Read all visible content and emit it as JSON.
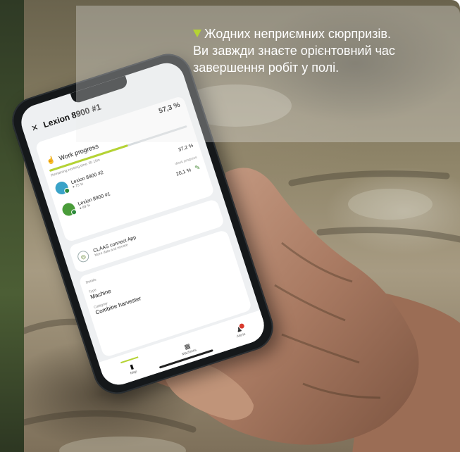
{
  "caption": {
    "lines": [
      "Жодних неприємних сюрпризів.",
      "Ви завжди знаєте орієнтовний час",
      "завершення робіт у полі."
    ],
    "accent_color": "#b5d334"
  },
  "phone_app": {
    "close_icon": "close-icon",
    "title": "Lexion 8900 #1",
    "progress_card": {
      "total_percent": "57,3 %",
      "progress_fraction": 0.573,
      "label": "Work progress",
      "remaining": "Remaining working time: 3h 15m",
      "machines": [
        {
          "name": "Lexion 8900 #2",
          "sub": "● 75 %",
          "percent": "37,2 %",
          "color": "#3aa3c8"
        },
        {
          "name": "Lexion 8900 #1",
          "sub": "● 89 %",
          "percent": "20,1 %",
          "color": "#4a9c3a"
        }
      ],
      "link": "Work progress"
    },
    "connect_card": {
      "title": "CLAAS connect App",
      "sub": "More data and remote"
    },
    "details_card": {
      "heading": "Details",
      "type_label": "Type",
      "type_value": "Machine",
      "category_label": "Category",
      "category_value": "Combine harvester"
    },
    "tabs": [
      {
        "label": "Map",
        "icon": "map-icon",
        "active": true
      },
      {
        "label": "Machines",
        "icon": "grid-icon",
        "active": false
      },
      {
        "label": "Alerts",
        "icon": "user-alert-icon",
        "active": false
      }
    ]
  }
}
